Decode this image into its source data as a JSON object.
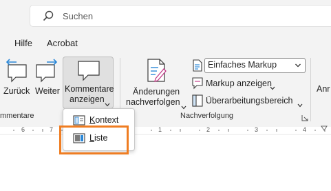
{
  "search": {
    "placeholder": "Suchen",
    "icon": "search-icon"
  },
  "tabs": [
    {
      "label": "Hilfe"
    },
    {
      "label": "Acrobat"
    }
  ],
  "ribbon": {
    "comments_group": {
      "label": "mmentare",
      "back_label": "Zurück",
      "next_label": "Weiter",
      "show_comments_line1": "Kommentare",
      "show_comments_line2": "anzeigen",
      "dropdown_chevron": "⌄"
    },
    "tracking_group": {
      "label": "Nachverfolgung",
      "track_changes_line1": "Änderungen",
      "track_changes_line2": "nachverfolgen",
      "markup_select_value": "Einfaches Markup",
      "show_markup_label": "Markup anzeigen",
      "review_pane_label": "Überarbeitungsbereich"
    },
    "next_group_partial": "Anr"
  },
  "dropdown_menu": {
    "items": [
      {
        "label": "Kontext",
        "accelerator": "K",
        "rest": "ontext"
      },
      {
        "label": "Liste",
        "accelerator": "L",
        "rest": "iste",
        "highlighted": true
      }
    ]
  },
  "ruler": {
    "labels": [
      "6",
      "7",
      "1",
      "2",
      "3",
      "4",
      "5"
    ]
  },
  "colors": {
    "accent_blue": "#2b88d8",
    "highlight_orange": "#ef7d22",
    "ribbon_bg": "#f3f3f3"
  }
}
